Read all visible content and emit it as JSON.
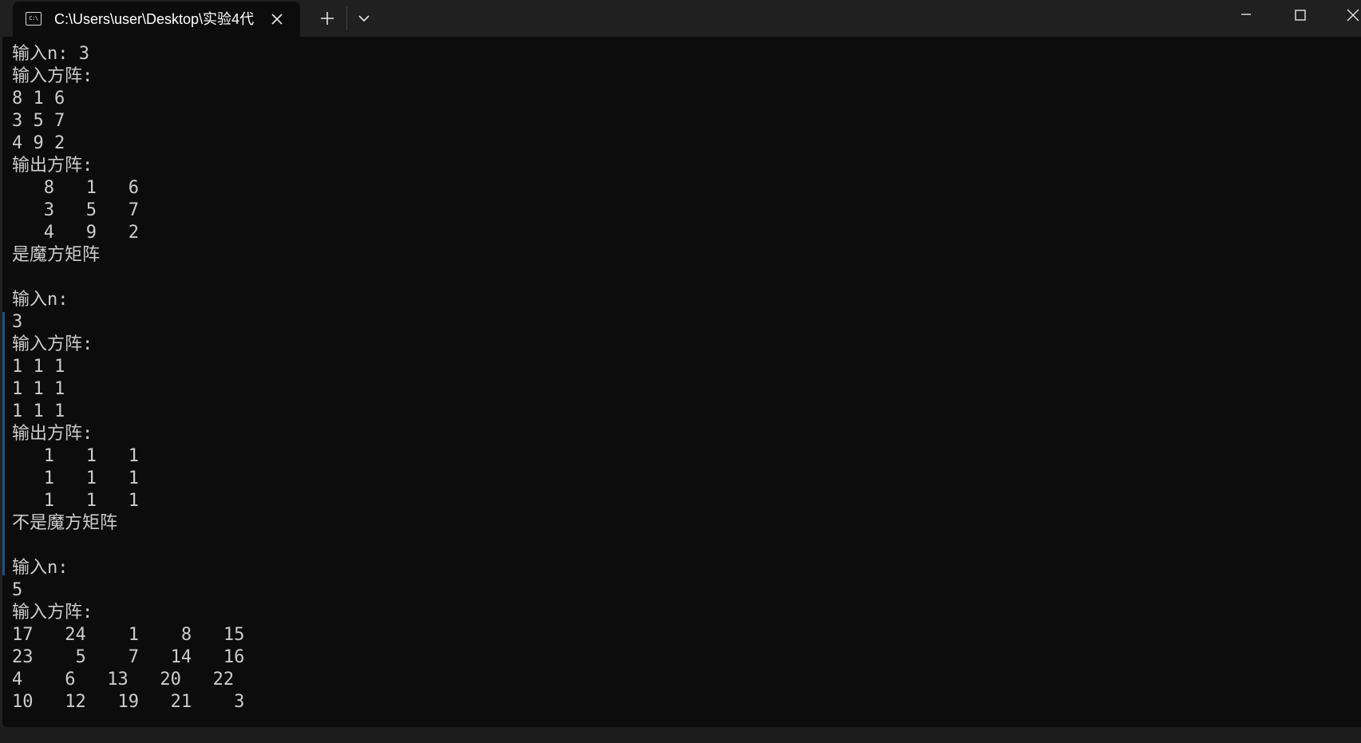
{
  "tab": {
    "icon_text": "C:\\",
    "title": "C:\\Users\\user\\Desktop\\实验4代"
  },
  "icons": {
    "tab_icon": "terminal-icon",
    "tab_close": "close-icon",
    "new_tab": "plus-icon",
    "dropdown": "chevron-down-icon",
    "minimize": "minimize-icon",
    "maximize": "maximize-icon",
    "close": "close-icon"
  },
  "colors": {
    "background": "#0c0c0c",
    "titlebar": "#202020",
    "text": "#cccccc",
    "scroll_mark": "#1f4f8a"
  },
  "terminal": {
    "lines": [
      "输入n: 3",
      "输入方阵:",
      "8 1 6",
      "3 5 7",
      "4 9 2",
      "输出方阵:",
      "   8   1   6",
      "   3   5   7",
      "   4   9   2",
      "是魔方矩阵",
      "",
      "输入n:",
      "3",
      "输入方阵:",
      "1 1 1",
      "1 1 1",
      "1 1 1",
      "输出方阵:",
      "   1   1   1",
      "   1   1   1",
      "   1   1   1",
      "不是魔方矩阵",
      "",
      "输入n:",
      "5",
      "输入方阵:",
      "17   24    1    8   15",
      "23    5    7   14   16",
      "4    6   13   20   22",
      "10   12   19   21    3"
    ]
  }
}
